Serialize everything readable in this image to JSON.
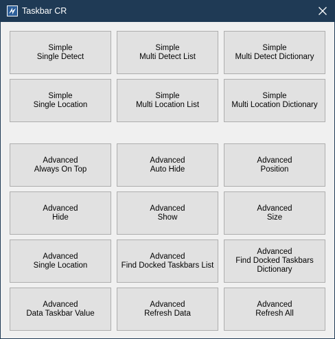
{
  "window": {
    "title": "Taskbar CR",
    "titlebar_color": "#1f3a55",
    "icons": {
      "app": "app-icon",
      "close": "close-icon"
    }
  },
  "simple_buttons": [
    {
      "line1": "Simple",
      "line2": "Single Detect"
    },
    {
      "line1": "Simple",
      "line2": "Multi Detect List"
    },
    {
      "line1": "Simple",
      "line2": "Multi Detect Dictionary"
    },
    {
      "line1": "Simple",
      "line2": "Single Location"
    },
    {
      "line1": "Simple",
      "line2": "Multi Location List"
    },
    {
      "line1": "Simple",
      "line2": "Multi Location Dictionary"
    }
  ],
  "advanced_buttons": [
    {
      "line1": "Advanced",
      "line2": "Always On Top"
    },
    {
      "line1": "Advanced",
      "line2": "Auto Hide"
    },
    {
      "line1": "Advanced",
      "line2": "Position"
    },
    {
      "line1": "Advanced",
      "line2": "Hide"
    },
    {
      "line1": "Advanced",
      "line2": "Show"
    },
    {
      "line1": "Advanced",
      "line2": "Size"
    },
    {
      "line1": "Advanced",
      "line2": "Single Location"
    },
    {
      "line1": "Advanced",
      "line2": "Find Docked Taskbars List"
    },
    {
      "line1": "Advanced",
      "line2": "Find Docked Taskbars",
      "line3": "Dictionary"
    },
    {
      "line1": "Advanced",
      "line2": "Data Taskbar Value"
    },
    {
      "line1": "Advanced",
      "line2": "Refresh Data"
    },
    {
      "line1": "Advanced",
      "line2": "Refresh All"
    }
  ]
}
